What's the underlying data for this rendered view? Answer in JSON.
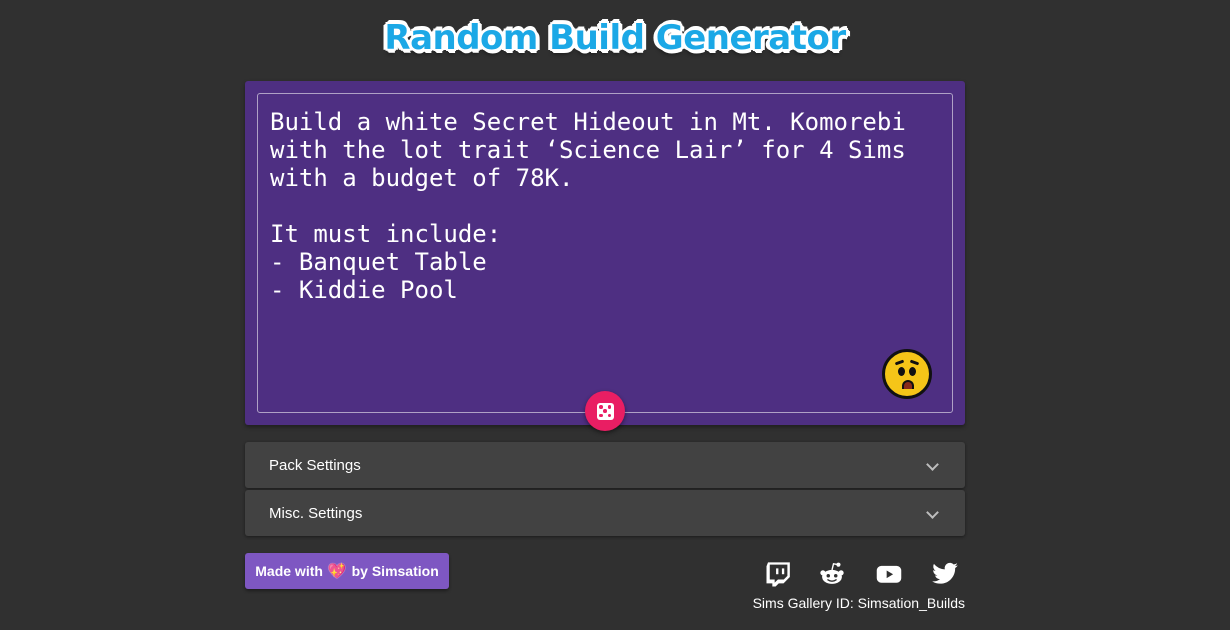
{
  "header": {
    "logo_text": "Random Build Generator"
  },
  "prompt": {
    "text": "Build a white Secret Hideout in Mt. Komorebi\nwith the lot trait ‘Science Lair’ for 4 Sims\nwith a budget of 78K.\n\nIt must include:\n- Banquet Table\n- Kiddie Pool",
    "emoji_icon": "worried-face-icon",
    "randomize_icon": "dice-icon"
  },
  "settings": {
    "panels": [
      {
        "label": "Pack Settings"
      },
      {
        "label": "Misc. Settings"
      }
    ]
  },
  "footer": {
    "made_with_prefix": "Made with",
    "heart": "💖",
    "made_with_suffix": "by Simsation",
    "social_icons": [
      "twitch-icon",
      "reddit-icon",
      "youtube-icon",
      "twitter-icon"
    ],
    "gallery_id": "Sims Gallery ID: Simsation_Builds"
  },
  "colors": {
    "background": "#303030",
    "card": "#4e2f82",
    "accent_pink": "#e91e63",
    "button_purple": "#7e57c2",
    "logo_blue": "#1ba8e6",
    "panel": "#424242"
  }
}
